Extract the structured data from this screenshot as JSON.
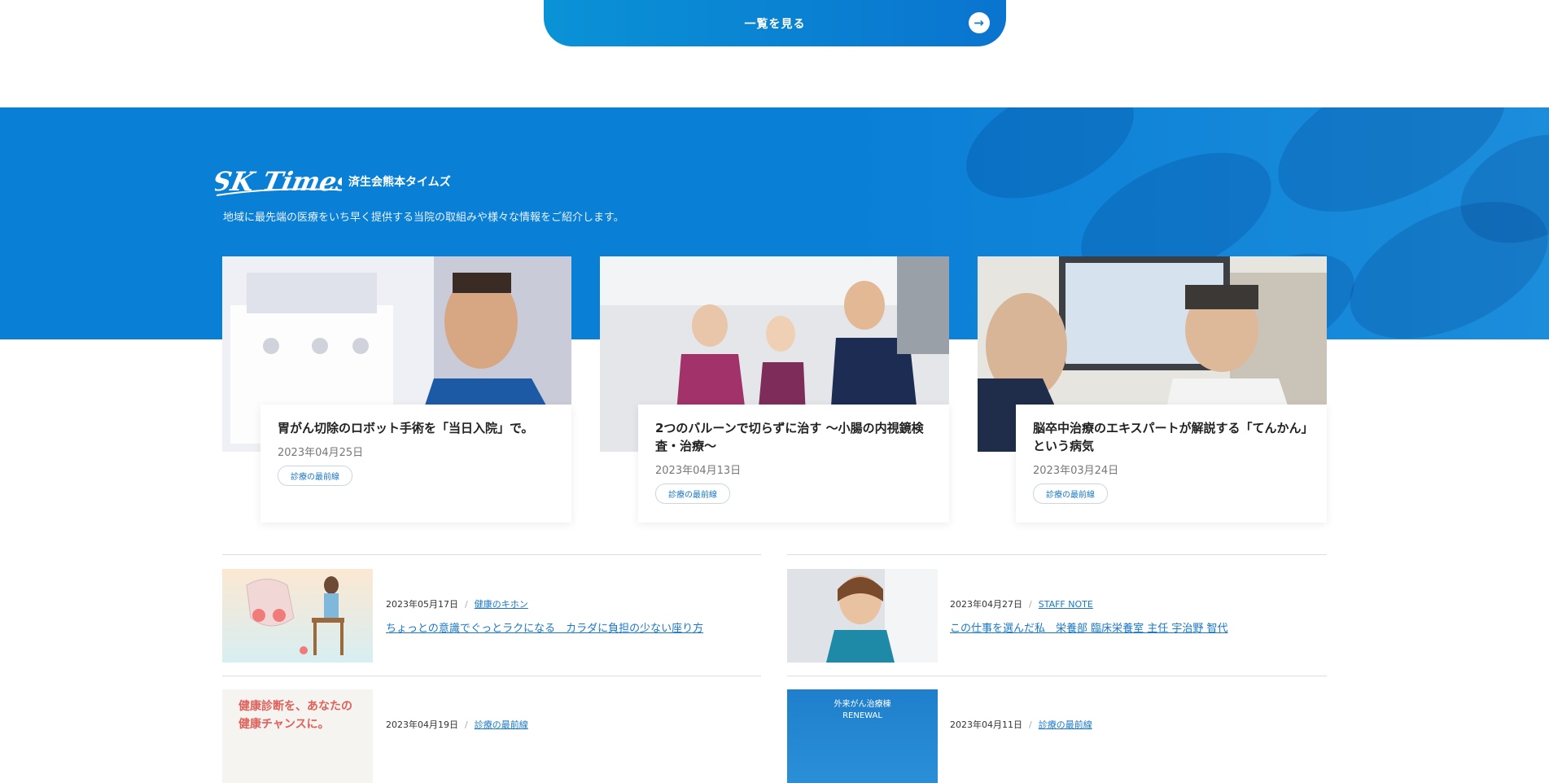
{
  "view_all": {
    "label": "一覧を見る"
  },
  "sk_times": {
    "logo_text": "SK Times",
    "subtitle": "済生会熊本タイムズ",
    "description": "地域に最先端の医療をいち早く提供する当院の取組みや様々な情報をご紹介します。"
  },
  "featured": [
    {
      "title": "胃がん切除のロボット手術を「当日入院」で。",
      "date": "2023年04月25日",
      "tag": "診療の最前線"
    },
    {
      "title": "2つのバルーンで切らずに治す ～小腸の内視鏡検査・治療～",
      "date": "2023年04月13日",
      "tag": "診療の最前線"
    },
    {
      "title": "脳卒中治療のエキスパートが解説する「てんかん」という病気",
      "date": "2023年03月24日",
      "tag": "診療の最前線"
    }
  ],
  "articles": [
    {
      "date": "2023年05月17日",
      "category": "健康のキホン",
      "title": "ちょっとの意識でぐっとラクになる　カラダに負担の少ない座り方"
    },
    {
      "date": "2023年04月27日",
      "category": "STAFF NOTE",
      "title": "この仕事を選んだ私　栄養部 臨床栄養室 主任 宇治野 智代"
    },
    {
      "date": "2023年04月19日",
      "category": "診療の最前線",
      "title": "",
      "thumb_text": "健康診断を、あなたの健康チャンスに。"
    },
    {
      "date": "2023年04月11日",
      "category": "診療の最前線",
      "title": "",
      "thumb_text": "外来がん治療棟 RENEWAL"
    }
  ],
  "colors": {
    "brand_blue": "#0a7fd6",
    "link_blue": "#1a78c8"
  }
}
